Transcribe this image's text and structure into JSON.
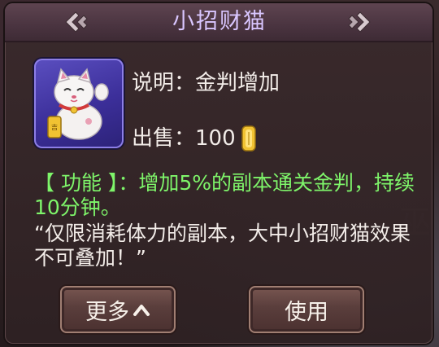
{
  "title": "小招财猫",
  "item": {
    "icon": "lucky-cat-icon",
    "description_label": "说明：",
    "description_value": "金判增加",
    "price_label": "出售：",
    "price_value": "100",
    "currency_icon": "gold-coin-icon"
  },
  "function_text": "【 功能 】：增加5%的副本通关金判，持续10分钟。",
  "note_text": "“仅限消耗体力的副本，大中小招财猫效果不可叠加！”",
  "buttons": {
    "more_label": "更多",
    "use_label": "使用"
  },
  "colors": {
    "title": "#d9c6ff",
    "function_text": "#7ef56a",
    "item_frame": "#4a3db0"
  }
}
